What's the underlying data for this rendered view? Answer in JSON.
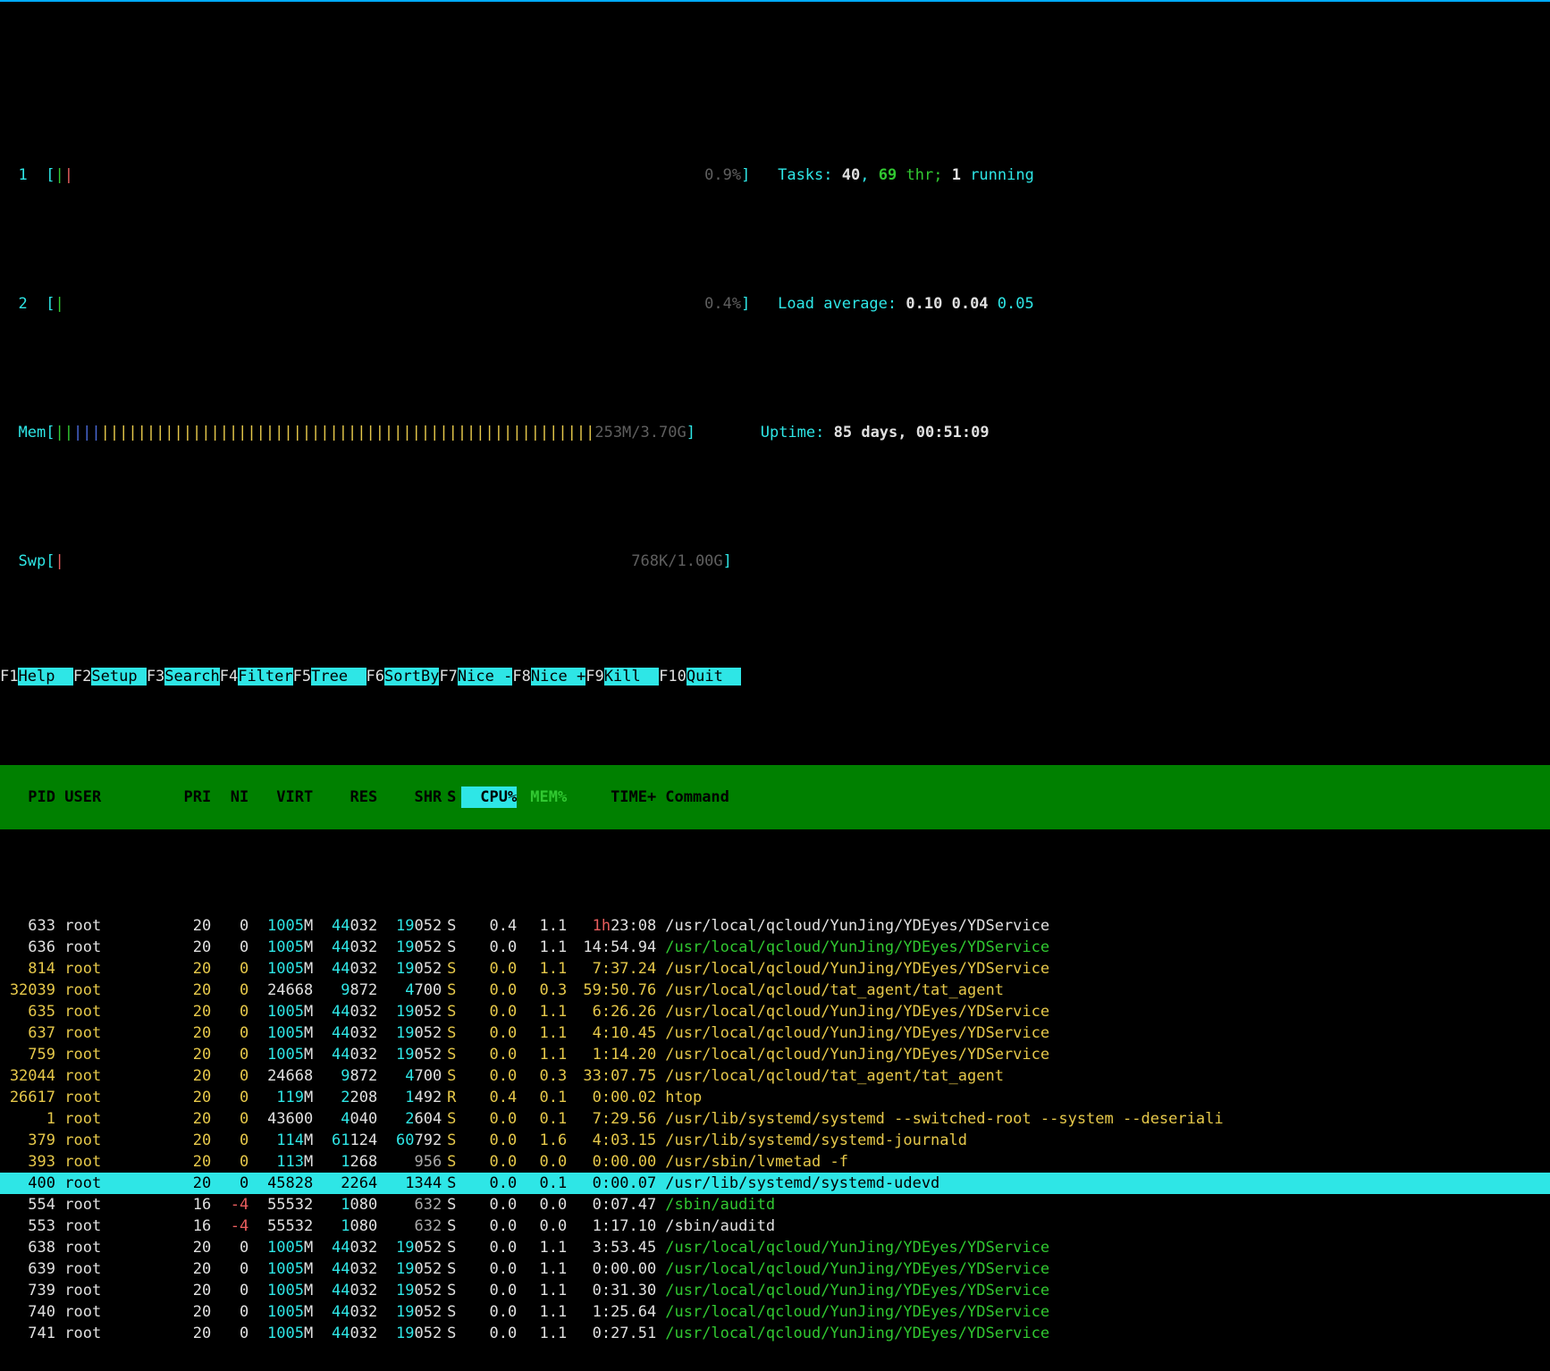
{
  "meters": {
    "cpu": [
      {
        "label": "1",
        "pct": "0.9%"
      },
      {
        "label": "2",
        "pct": "0.4%"
      }
    ],
    "mem": {
      "label": "Mem",
      "used": "253M",
      "total": "3.70G"
    },
    "swp": {
      "label": "Swp",
      "used": "768K",
      "total": "1.00G"
    }
  },
  "info": {
    "tasks_label": "Tasks:",
    "tasks_n": "40",
    "tasks_sep": ",",
    "tasks_thr": "69",
    "thr_label": "thr;",
    "tasks_run": "1",
    "running_label": "running",
    "load_label": "Load average:",
    "la1": "0.10",
    "la5": "0.04",
    "la15": "0.05",
    "uptime_label": "Uptime:",
    "uptime": "85 days, 00:51:09"
  },
  "columns": {
    "pid": "PID",
    "user": "USER",
    "pri": "PRI",
    "ni": "NI",
    "virt": "VIRT",
    "res": "RES",
    "shr": "SHR",
    "s": "S",
    "cpu": "CPU%",
    "mem": "MEM%",
    "time": "TIME+",
    "cmd": "Command"
  },
  "rows": [
    {
      "sel": false,
      "color": "white",
      "pid": "633",
      "user": "root",
      "pri": "20",
      "ni": "0",
      "virt": "1005M",
      "res": "44032",
      "shr": "19052",
      "s": "S",
      "cpu": "0.4",
      "mem": "1.1",
      "time": "1h23:08",
      "time_hi": "1h",
      "cmd": "/usr/local/qcloud/YunJing/YDEyes/YDService",
      "dim": false
    },
    {
      "sel": false,
      "color": "white",
      "pid": "636",
      "user": "root",
      "pri": "20",
      "ni": "0",
      "virt": "1005M",
      "res": "44032",
      "shr": "19052",
      "s": "S",
      "cpu": "0.0",
      "mem": "1.1",
      "time": "14:54.94",
      "cmd": "/usr/local/qcloud/YunJing/YDEyes/YDService",
      "dim": true
    },
    {
      "sel": false,
      "color": "yellow",
      "pid": "814",
      "user": "root",
      "pri": "20",
      "ni": "0",
      "virt": "1005M",
      "res": "44032",
      "shr": "19052",
      "s": "S",
      "cpu": "0.0",
      "mem": "1.1",
      "time": "7:37.24",
      "cmd": "/usr/local/qcloud/YunJing/YDEyes/YDService"
    },
    {
      "sel": false,
      "color": "yellow",
      "pid": "32039",
      "user": "root",
      "pri": "20",
      "ni": "0",
      "virt": "24668",
      "res": "9872",
      "shr": "4700",
      "s": "S",
      "cpu": "0.0",
      "mem": "0.3",
      "time": "59:50.76",
      "cmd": "/usr/local/qcloud/tat_agent/tat_agent"
    },
    {
      "sel": false,
      "color": "yellow",
      "pid": "635",
      "user": "root",
      "pri": "20",
      "ni": "0",
      "virt": "1005M",
      "res": "44032",
      "shr": "19052",
      "s": "S",
      "cpu": "0.0",
      "mem": "1.1",
      "time": "6:26.26",
      "cmd": "/usr/local/qcloud/YunJing/YDEyes/YDService"
    },
    {
      "sel": false,
      "color": "yellow",
      "pid": "637",
      "user": "root",
      "pri": "20",
      "ni": "0",
      "virt": "1005M",
      "res": "44032",
      "shr": "19052",
      "s": "S",
      "cpu": "0.0",
      "mem": "1.1",
      "time": "4:10.45",
      "cmd": "/usr/local/qcloud/YunJing/YDEyes/YDService"
    },
    {
      "sel": false,
      "color": "yellow",
      "pid": "759",
      "user": "root",
      "pri": "20",
      "ni": "0",
      "virt": "1005M",
      "res": "44032",
      "shr": "19052",
      "s": "S",
      "cpu": "0.0",
      "mem": "1.1",
      "time": "1:14.20",
      "cmd": "/usr/local/qcloud/YunJing/YDEyes/YDService"
    },
    {
      "sel": false,
      "color": "yellow",
      "pid": "32044",
      "user": "root",
      "pri": "20",
      "ni": "0",
      "virt": "24668",
      "res": "9872",
      "shr": "4700",
      "s": "S",
      "cpu": "0.0",
      "mem": "0.3",
      "time": "33:07.75",
      "cmd": "/usr/local/qcloud/tat_agent/tat_agent"
    },
    {
      "sel": false,
      "color": "yellow",
      "pid": "26617",
      "user": "root",
      "pri": "20",
      "ni": "0",
      "virt": "119M",
      "res": "2208",
      "shr": "1492",
      "s": "R",
      "cpu": "0.4",
      "mem": "0.1",
      "time": "0:00.02",
      "cmd": "htop"
    },
    {
      "sel": false,
      "color": "yellow",
      "pid": "1",
      "user": "root",
      "pri": "20",
      "ni": "0",
      "virt": "43600",
      "res": "4040",
      "shr": "2604",
      "s": "S",
      "cpu": "0.0",
      "mem": "0.1",
      "time": "7:29.56",
      "cmd": "/usr/lib/systemd/systemd --switched-root --system --deseriali"
    },
    {
      "sel": false,
      "color": "yellow",
      "pid": "379",
      "user": "root",
      "pri": "20",
      "ni": "0",
      "virt": "114M",
      "res": "61124",
      "shr": "60792",
      "s": "S",
      "cpu": "0.0",
      "mem": "1.6",
      "time": "4:03.15",
      "cmd": "/usr/lib/systemd/systemd-journald"
    },
    {
      "sel": false,
      "color": "yellow",
      "pid": "393",
      "user": "root",
      "pri": "20",
      "ni": "0",
      "virt": "113M",
      "res": "1268",
      "shr": "956",
      "s": "S",
      "cpu": "0.0",
      "mem": "0.0",
      "time": "0:00.00",
      "cmd": "/usr/sbin/lvmetad -f"
    },
    {
      "sel": true,
      "color": "white",
      "pid": "400",
      "user": "root",
      "pri": "20",
      "ni": "0",
      "virt": "45828",
      "res": "2264",
      "shr": "1344",
      "s": "S",
      "cpu": "0.0",
      "mem": "0.1",
      "time": "0:00.07",
      "cmd": "/usr/lib/systemd/systemd-udevd"
    },
    {
      "sel": false,
      "color": "white",
      "pid": "554",
      "user": "root",
      "pri": "16",
      "ni": "-4",
      "virt": "55532",
      "res": "1080",
      "shr": "632",
      "s": "S",
      "cpu": "0.0",
      "mem": "0.0",
      "time": "0:07.47",
      "cmd": "/sbin/auditd",
      "dim": true,
      "nired": true
    },
    {
      "sel": false,
      "color": "white",
      "pid": "553",
      "user": "root",
      "pri": "16",
      "ni": "-4",
      "virt": "55532",
      "res": "1080",
      "shr": "632",
      "s": "S",
      "cpu": "0.0",
      "mem": "0.0",
      "time": "1:17.10",
      "cmd": "/sbin/auditd",
      "nired": true
    },
    {
      "sel": false,
      "color": "white",
      "pid": "638",
      "user": "root",
      "pri": "20",
      "ni": "0",
      "virt": "1005M",
      "res": "44032",
      "shr": "19052",
      "s": "S",
      "cpu": "0.0",
      "mem": "1.1",
      "time": "3:53.45",
      "cmd": "/usr/local/qcloud/YunJing/YDEyes/YDService",
      "dim": true
    },
    {
      "sel": false,
      "color": "white",
      "pid": "639",
      "user": "root",
      "pri": "20",
      "ni": "0",
      "virt": "1005M",
      "res": "44032",
      "shr": "19052",
      "s": "S",
      "cpu": "0.0",
      "mem": "1.1",
      "time": "0:00.00",
      "cmd": "/usr/local/qcloud/YunJing/YDEyes/YDService",
      "dim": true
    },
    {
      "sel": false,
      "color": "white",
      "pid": "739",
      "user": "root",
      "pri": "20",
      "ni": "0",
      "virt": "1005M",
      "res": "44032",
      "shr": "19052",
      "s": "S",
      "cpu": "0.0",
      "mem": "1.1",
      "time": "0:31.30",
      "cmd": "/usr/local/qcloud/YunJing/YDEyes/YDService",
      "dim": true
    },
    {
      "sel": false,
      "color": "white",
      "pid": "740",
      "user": "root",
      "pri": "20",
      "ni": "0",
      "virt": "1005M",
      "res": "44032",
      "shr": "19052",
      "s": "S",
      "cpu": "0.0",
      "mem": "1.1",
      "time": "1:25.64",
      "cmd": "/usr/local/qcloud/YunJing/YDEyes/YDService",
      "dim": true
    },
    {
      "sel": false,
      "color": "white",
      "pid": "741",
      "user": "root",
      "pri": "20",
      "ni": "0",
      "virt": "1005M",
      "res": "44032",
      "shr": "19052",
      "s": "S",
      "cpu": "0.0",
      "mem": "1.1",
      "time": "0:27.51",
      "cmd": "/usr/local/qcloud/YunJing/YDEyes/YDService",
      "dim": true
    }
  ],
  "footer": [
    {
      "key": "F1",
      "label": "Help  "
    },
    {
      "key": "F2",
      "label": "Setup "
    },
    {
      "key": "F3",
      "label": "Search"
    },
    {
      "key": "F4",
      "label": "Filter"
    },
    {
      "key": "F5",
      "label": "Tree  "
    },
    {
      "key": "F6",
      "label": "SortBy"
    },
    {
      "key": "F7",
      "label": "Nice -"
    },
    {
      "key": "F8",
      "label": "Nice +"
    },
    {
      "key": "F9",
      "label": "Kill  "
    },
    {
      "key": "F10",
      "label": "Quit  "
    }
  ]
}
